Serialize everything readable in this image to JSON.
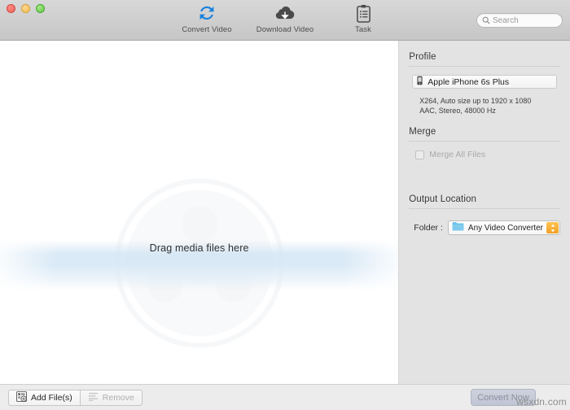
{
  "window": {
    "traffic_lights": [
      {
        "name": "close",
        "color": "#ec6358"
      },
      {
        "name": "minimize",
        "color": "#f6bf4f"
      },
      {
        "name": "maximize",
        "color": "#61c646"
      }
    ]
  },
  "toolbar": {
    "items": [
      {
        "label": "Convert Video",
        "icon": "convert-refresh-icon",
        "color": "#1a82dd"
      },
      {
        "label": "Download Video",
        "icon": "download-cloud-icon",
        "color": "#4a4a4a"
      },
      {
        "label": "Task",
        "icon": "clipboard-task-icon",
        "color": "#4a4a4a"
      }
    ],
    "search": {
      "placeholder": "Search",
      "value": ""
    }
  },
  "dropzone": {
    "label": "Drag media files here"
  },
  "panel": {
    "profile": {
      "title": "Profile",
      "selected": "Apple iPhone 6s Plus",
      "meta_line_1": "X264, Auto size up to 1920 x 1080",
      "meta_line_2": "AAC, Stereo, 48000 Hz"
    },
    "merge": {
      "title": "Merge",
      "checkbox_label": "Merge All Files",
      "checked": false,
      "enabled": false
    },
    "output": {
      "title": "Output Location",
      "folder_caption": "Folder :",
      "folder_value": "Any Video Converter",
      "folder_icon_color": "#6cc0ea",
      "stepper_color": "#f0a026"
    }
  },
  "bottombar": {
    "add_files_label": "Add File(s)",
    "remove_label": "Remove",
    "convert_label": "Convert Now",
    "watermark": "wsxdn.com"
  }
}
